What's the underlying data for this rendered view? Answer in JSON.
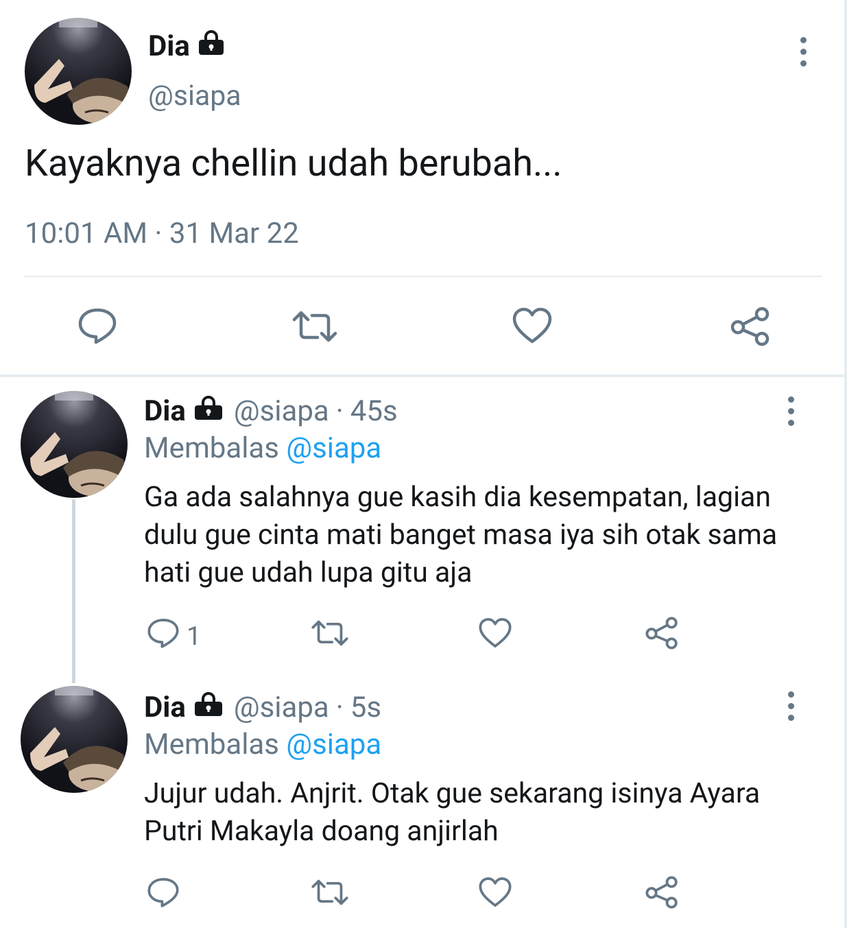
{
  "main_tweet": {
    "name": "Dia",
    "handle": "@siapa",
    "text": "Kayaknya chellin udah berubah...",
    "timestamp": "10:01 AM · 31 Mar 22",
    "actions": [
      "reply-icon",
      "retweet-icon",
      "like-icon",
      "share-icon"
    ]
  },
  "replies": [
    {
      "name": "Dia",
      "handle": "@siapa",
      "separator": "·",
      "age": "45s",
      "replying_label": "Membalas",
      "replying_to": "@siapa",
      "text": "Ga ada salahnya gue kasih dia kesempatan, lagian dulu gue cinta mati banget masa iya sih otak sama hati gue udah lupa gitu aja",
      "reply_count": "1"
    },
    {
      "name": "Dia",
      "handle": "@siapa",
      "separator": "·",
      "age": "5s",
      "replying_label": "Membalas",
      "replying_to": "@siapa",
      "text": "Jujur udah. Anjrit. Otak gue sekarang isinya Ayara Putri Makayla  doang anjirlah",
      "reply_count": ""
    }
  ],
  "colors": {
    "text": "#14171a",
    "secondary": "#657786",
    "accent": "#1da1f2",
    "divider": "#e6ecf0"
  }
}
